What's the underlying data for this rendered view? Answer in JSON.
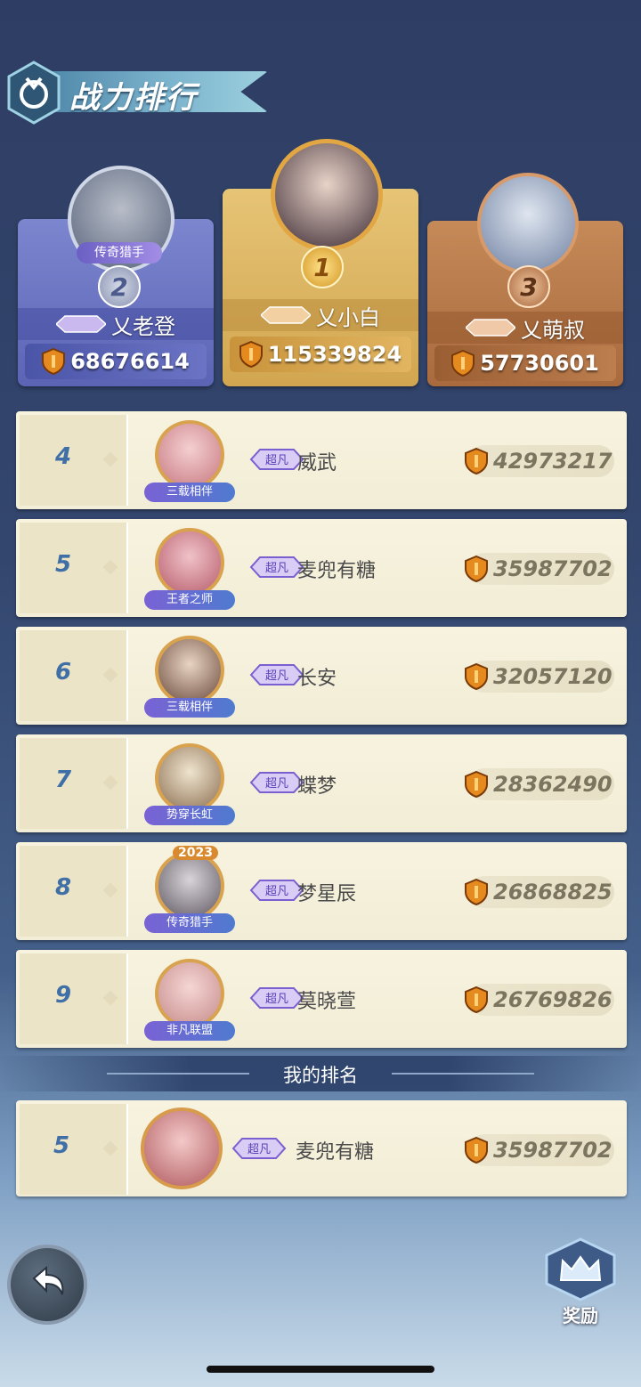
{
  "header": {
    "title": "战力排行"
  },
  "podium": [
    {
      "rank": "1",
      "name": "乂小白",
      "score": "115339824",
      "badge": ""
    },
    {
      "rank": "2",
      "name": "乂老登",
      "score": "68676614",
      "badge": "传奇猎手"
    },
    {
      "rank": "3",
      "name": "乂萌叔",
      "score": "57730601",
      "badge": ""
    }
  ],
  "tier_label": "超凡",
  "rows": [
    {
      "rank": "4",
      "name": "威武",
      "score": "42973217",
      "frame": "三载相伴"
    },
    {
      "rank": "5",
      "name": "麦兜有糖",
      "score": "35987702",
      "frame": "王者之师"
    },
    {
      "rank": "6",
      "name": "长安",
      "score": "32057120",
      "frame": "三载相伴"
    },
    {
      "rank": "7",
      "name": "蝶梦",
      "score": "28362490",
      "frame": "势穿长虹"
    },
    {
      "rank": "8",
      "name": "梦星辰",
      "score": "26868825",
      "frame": "传奇猎手",
      "year": "2023"
    },
    {
      "rank": "9",
      "name": "莫晓萱",
      "score": "26769826",
      "frame": "非凡联盟"
    }
  ],
  "my_rank": {
    "label": "我的排名",
    "rank": "5",
    "name": "麦兜有糖",
    "score": "35987702"
  },
  "buttons": {
    "reward": "奖励"
  }
}
